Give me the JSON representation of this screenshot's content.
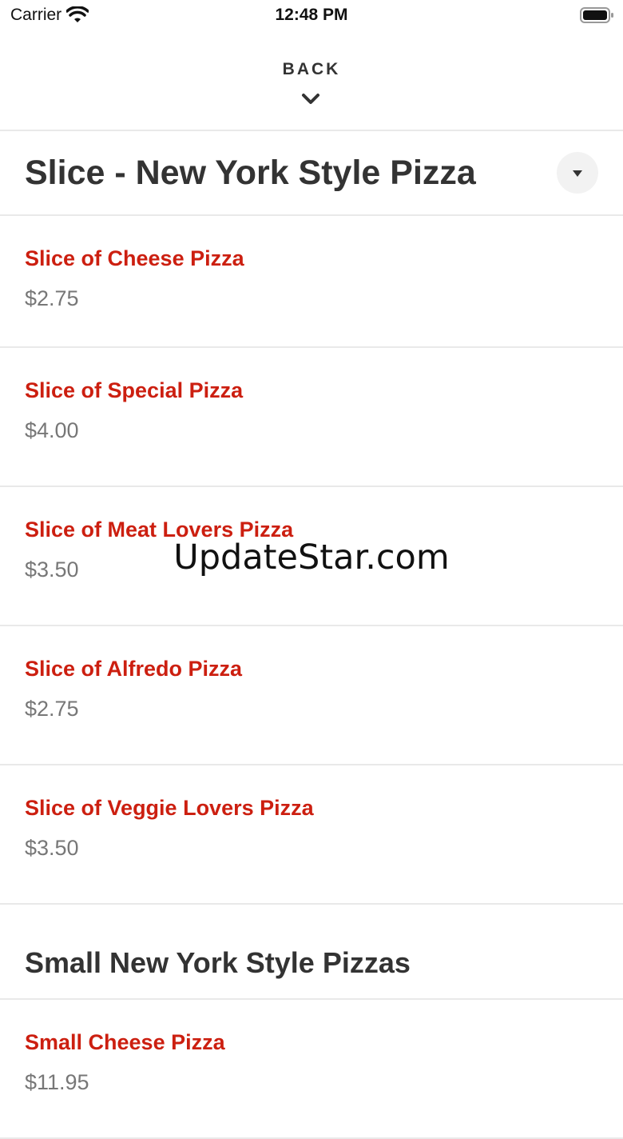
{
  "status_bar": {
    "carrier": "Carrier",
    "time": "12:48 PM",
    "wifi_icon": "wifi-icon",
    "battery_icon": "battery-icon"
  },
  "nav": {
    "back_label": "BACK",
    "back_icon": "chevron-down-icon"
  },
  "category": {
    "title": "Slice - New York Style Pizza",
    "toggle_icon": "caret-down-icon"
  },
  "items": [
    {
      "name": "Slice of Cheese Pizza",
      "price": "$2.75"
    },
    {
      "name": "Slice of Special Pizza",
      "price": "$4.00"
    },
    {
      "name": "Slice of Meat Lovers Pizza",
      "price": "$3.50"
    },
    {
      "name": "Slice of Alfredo Pizza",
      "price": "$2.75"
    },
    {
      "name": "Slice of Veggie Lovers Pizza",
      "price": "$3.50"
    }
  ],
  "section2": {
    "title": "Small New York Style Pizzas",
    "items": [
      {
        "name": "Small Cheese Pizza",
        "price": "$11.95"
      }
    ]
  },
  "watermark": "UpdateStar.com",
  "colors": {
    "item_name": "#cc1f10",
    "price": "#777777",
    "heading": "#333333",
    "divider": "#e9e9e9"
  }
}
